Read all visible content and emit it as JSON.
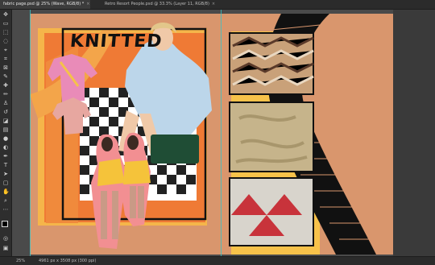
{
  "tabs": [
    {
      "label": "fabric page.psd @ 25% (Wave, RGB/8) *",
      "close": "×"
    },
    {
      "label": "Retro Resort People.psd @ 33.3% (Layer 11, RGB/8)",
      "close": "×"
    }
  ],
  "poster": {
    "headline": "KNITTED"
  },
  "status": {
    "zoom": "25%",
    "doc_size": "4961 px x 3508 px (300 ppi)"
  },
  "colors": {
    "pasteboard": "#4a4a4a",
    "artboard": "#d9966d",
    "guide": "#33c3c7",
    "accent_orange": "#e8622d",
    "accent_yellow": "#f7c24a"
  },
  "tools": [
    "move-tool-icon",
    "artboard-tool-icon",
    "marquee-tool-icon",
    "lasso-tool-icon",
    "object-select-icon",
    "crop-tool-icon",
    "frame-tool-icon",
    "eyedropper-icon",
    "healing-brush-icon",
    "brush-tool-icon",
    "clone-stamp-icon",
    "history-brush-icon",
    "eraser-icon",
    "gradient-icon",
    "blur-icon",
    "dodge-icon",
    "pen-tool-icon",
    "type-tool-icon",
    "path-select-icon",
    "shape-tool-icon",
    "hand-tool-icon",
    "zoom-tool-icon",
    "edit-toolbar-icon",
    "colors-icon",
    "quick-mask-icon",
    "screen-mode-icon"
  ]
}
